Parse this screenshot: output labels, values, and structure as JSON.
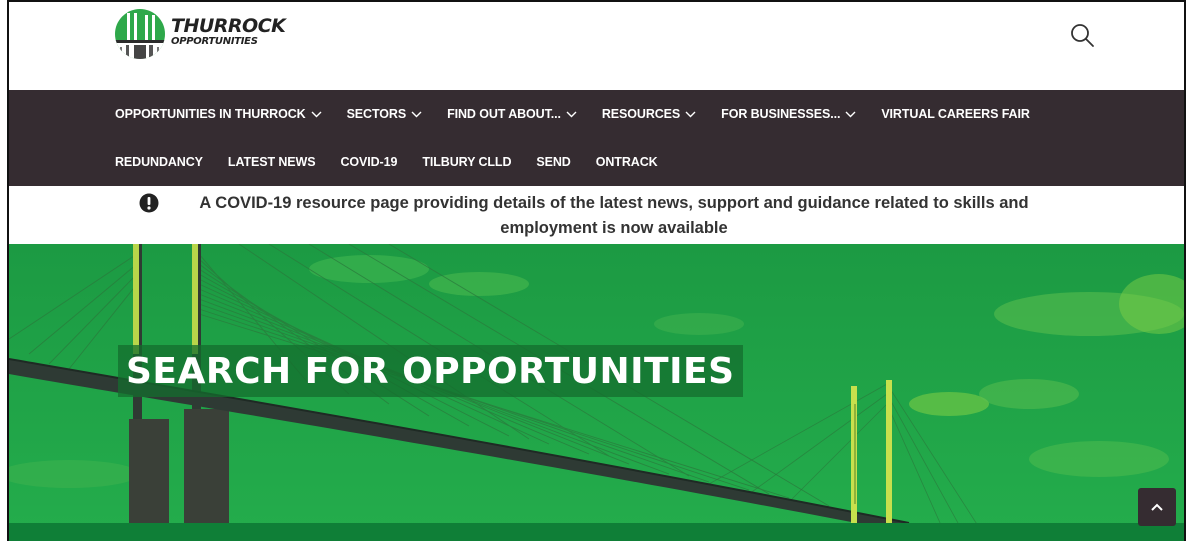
{
  "header": {
    "logo": {
      "line1": "THURROCK",
      "line2": "OPPORTUNITIES",
      "icon": "bridge-logo-icon"
    },
    "search_icon": "search-icon"
  },
  "nav": {
    "row1": [
      {
        "label": "OPPORTUNITIES IN THURROCK",
        "dropdown": true
      },
      {
        "label": "SECTORS",
        "dropdown": true
      },
      {
        "label": "FIND OUT ABOUT...",
        "dropdown": true
      },
      {
        "label": "RESOURCES",
        "dropdown": true
      },
      {
        "label": "FOR BUSINESSES...",
        "dropdown": true
      },
      {
        "label": "VIRTUAL CAREERS FAIR",
        "dropdown": false
      }
    ],
    "row2": [
      {
        "label": "REDUNDANCY",
        "dropdown": false
      },
      {
        "label": "LATEST NEWS",
        "dropdown": false
      },
      {
        "label": "COVID-19",
        "dropdown": false
      },
      {
        "label": "TILBURY CLLD",
        "dropdown": false
      },
      {
        "label": "SEND",
        "dropdown": false
      },
      {
        "label": "ONTRACK",
        "dropdown": false
      }
    ],
    "background": "#352c31"
  },
  "alert": {
    "icon": "exclamation-circle-icon",
    "text": "A COVID-19 resource page providing details of the latest news, support and guidance related to skills and employment is now available"
  },
  "hero": {
    "title": "SEARCH FOR OPPORTUNITIES",
    "accent": "#1fa447"
  },
  "back_to_top": {
    "icon": "chevron-up-icon"
  }
}
